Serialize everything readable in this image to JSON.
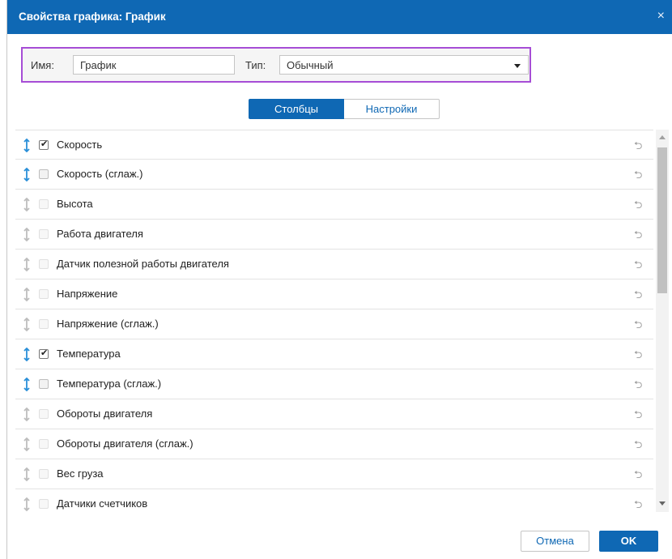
{
  "dialog": {
    "title": "Свойства графика: График",
    "close_label": "×"
  },
  "properties": {
    "name_label": "Имя:",
    "name_value": "График",
    "type_label": "Тип:",
    "type_value": "Обычный"
  },
  "tabs": [
    {
      "label": "Столбцы",
      "active": true
    },
    {
      "label": "Настройки",
      "active": false
    }
  ],
  "columns": [
    {
      "label": "Скорость",
      "checked": true,
      "enabled": true
    },
    {
      "label": "Скорость (сглаж.)",
      "checked": false,
      "enabled": true
    },
    {
      "label": "Высота",
      "checked": false,
      "enabled": false
    },
    {
      "label": "Работа двигателя",
      "checked": false,
      "enabled": false
    },
    {
      "label": "Датчик полезной работы двигателя",
      "checked": false,
      "enabled": false
    },
    {
      "label": "Напряжение",
      "checked": false,
      "enabled": false
    },
    {
      "label": "Напряжение (сглаж.)",
      "checked": false,
      "enabled": false
    },
    {
      "label": "Температура",
      "checked": true,
      "enabled": true
    },
    {
      "label": "Температура (сглаж.)",
      "checked": false,
      "enabled": true
    },
    {
      "label": "Обороты двигателя",
      "checked": false,
      "enabled": false
    },
    {
      "label": "Обороты двигателя (сглаж.)",
      "checked": false,
      "enabled": false
    },
    {
      "label": "Вес груза",
      "checked": false,
      "enabled": false
    },
    {
      "label": "Датчики счетчиков",
      "checked": false,
      "enabled": false
    }
  ],
  "icons": {
    "drag": "drag-handle-icon",
    "reset": "reset-icon",
    "check": "✔",
    "reset_glyph": "⮌"
  },
  "colors": {
    "accent": "#0f68b4",
    "highlight_border": "#a64dd6",
    "drag_active": "#2a8fd8",
    "drag_inactive": "#bdbdbd"
  },
  "footer": {
    "cancel_label": "Отмена",
    "ok_label": "OK"
  }
}
